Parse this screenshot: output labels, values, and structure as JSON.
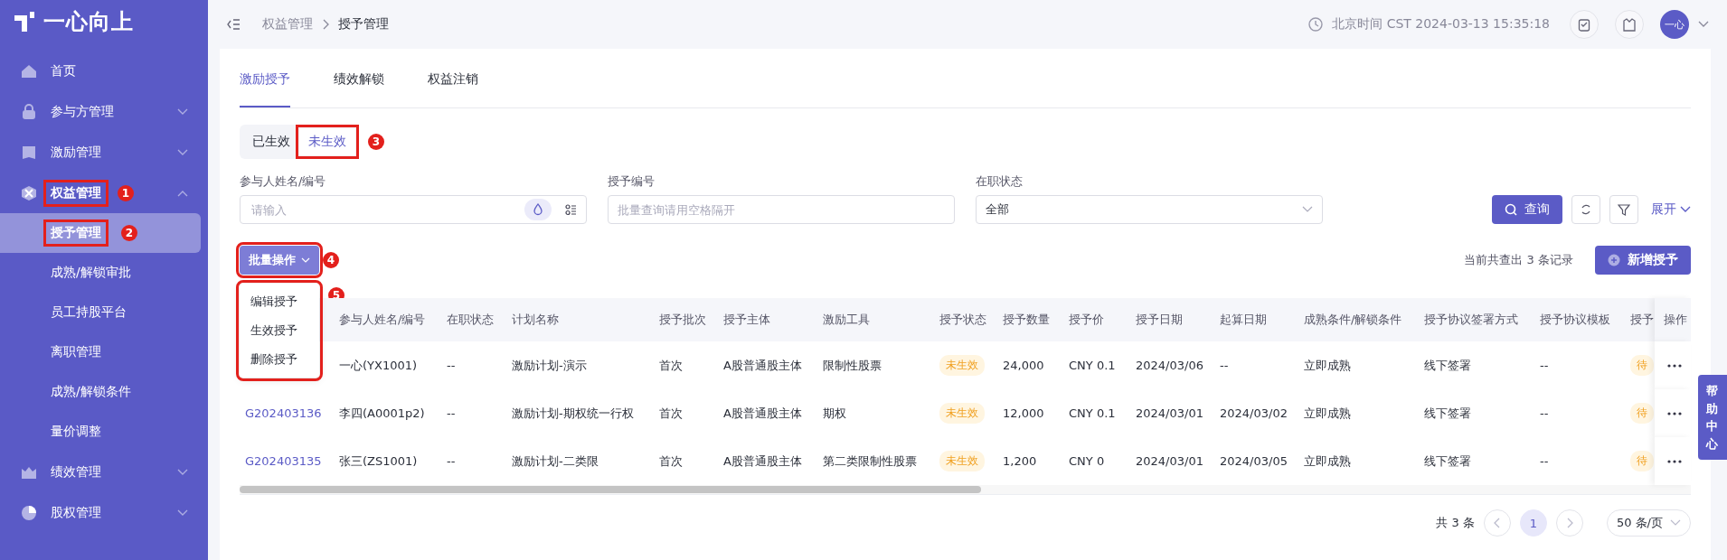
{
  "sidebar": {
    "logo": "一心向上",
    "items": [
      {
        "kind": "link",
        "label": "首页"
      },
      {
        "kind": "group",
        "label": "参与方管理",
        "expanded": false
      },
      {
        "kind": "group",
        "label": "激励管理",
        "expanded": false
      },
      {
        "kind": "group",
        "label": "权益管理",
        "expanded": true,
        "callout": "1",
        "children": [
          {
            "label": "授予管理",
            "selected": true,
            "callout": "2"
          },
          {
            "label": "成熟/解锁审批",
            "selected": false
          },
          {
            "label": "员工持股平台",
            "selected": false
          },
          {
            "label": "离职管理",
            "selected": false
          },
          {
            "label": "成熟/解锁条件",
            "selected": false
          },
          {
            "label": "量价调整",
            "selected": false
          }
        ]
      },
      {
        "kind": "group",
        "label": "绩效管理",
        "expanded": false
      },
      {
        "kind": "group",
        "label": "股权管理",
        "expanded": false
      }
    ]
  },
  "header": {
    "breadcrumb": [
      "权益管理",
      "授予管理"
    ],
    "clock": "北京时间 CST 2024-03-13 15:35:18",
    "avatar": "一心"
  },
  "tabs": [
    {
      "label": "激励授予",
      "selected": true
    },
    {
      "label": "绩效解锁",
      "selected": false
    },
    {
      "label": "权益注销",
      "selected": false
    }
  ],
  "status_tabs": [
    {
      "label": "已生效",
      "selected": false
    },
    {
      "label": "未生效",
      "selected": true,
      "callout": "3"
    }
  ],
  "filters": [
    {
      "kind": "search",
      "label": "参与人姓名/编号",
      "placeholder": "请输入"
    },
    {
      "kind": "text",
      "label": "授予编号",
      "placeholder": "批量查询请用空格隔开"
    },
    {
      "kind": "select",
      "label": "在职状态",
      "value": "全部"
    }
  ],
  "search_button": "查询",
  "expand_link": "展开",
  "batch": {
    "label": "批量操作",
    "callout": "4",
    "menu": {
      "callout": "5",
      "items": [
        "编辑授予",
        "生效授予",
        "删除授予"
      ]
    }
  },
  "record_count": "当前共查出 3 条记录",
  "add_button": "新增授予",
  "table": {
    "columns": [
      "",
      "参与人姓名/编号",
      "在职状态",
      "计划名称",
      "授予批次",
      "授予主体",
      "激励工具",
      "授予状态",
      "授予数量",
      "授予价",
      "授予日期",
      "起算日期",
      "成熟条件/解锁条件",
      "授予协议签署方式",
      "授予协议模板",
      "授予",
      "操作"
    ],
    "rows": [
      {
        "grant_no": "",
        "participant": "一心(YX1001)",
        "employment": "--",
        "plan": "激励计划-演示",
        "batch": "首次",
        "entity": "A股普通股主体",
        "tool": "限制性股票",
        "status": "未生效",
        "quantity": "24,000",
        "price": "CNY  0.1",
        "grant_date": "2024/03/06",
        "start_date": "--",
        "condition": "立即成熟",
        "sign_method": "线下签署",
        "template": "--",
        "column_16": "待"
      },
      {
        "grant_no": "G202403136",
        "participant": "李四(A0001p2)",
        "employment": "--",
        "plan": "激励计划-期权统一行权",
        "batch": "首次",
        "entity": "A股普通股主体",
        "tool": "期权",
        "status": "未生效",
        "quantity": "12,000",
        "price": "CNY  0.1",
        "grant_date": "2024/03/01",
        "start_date": "2024/03/02",
        "condition": "立即成熟",
        "sign_method": "线下签署",
        "template": "--",
        "column_16": "待"
      },
      {
        "grant_no": "G202403135",
        "participant": "张三(ZS1001)",
        "employment": "--",
        "plan": "激励计划-二类限",
        "batch": "首次",
        "entity": "A股普通股主体",
        "tool": "第二类限制性股票",
        "status": "未生效",
        "quantity": "1,200",
        "price": "CNY  0",
        "grant_date": "2024/03/01",
        "start_date": "2024/03/05",
        "condition": "立即成熟",
        "sign_method": "线下签署",
        "template": "--",
        "column_16": "待"
      }
    ]
  },
  "pagination": {
    "total": "共 3 条",
    "pages": [
      {
        "label": "1",
        "selected": true
      }
    ],
    "page_size": "50 条/页"
  },
  "help_tab": "帮助中心"
}
